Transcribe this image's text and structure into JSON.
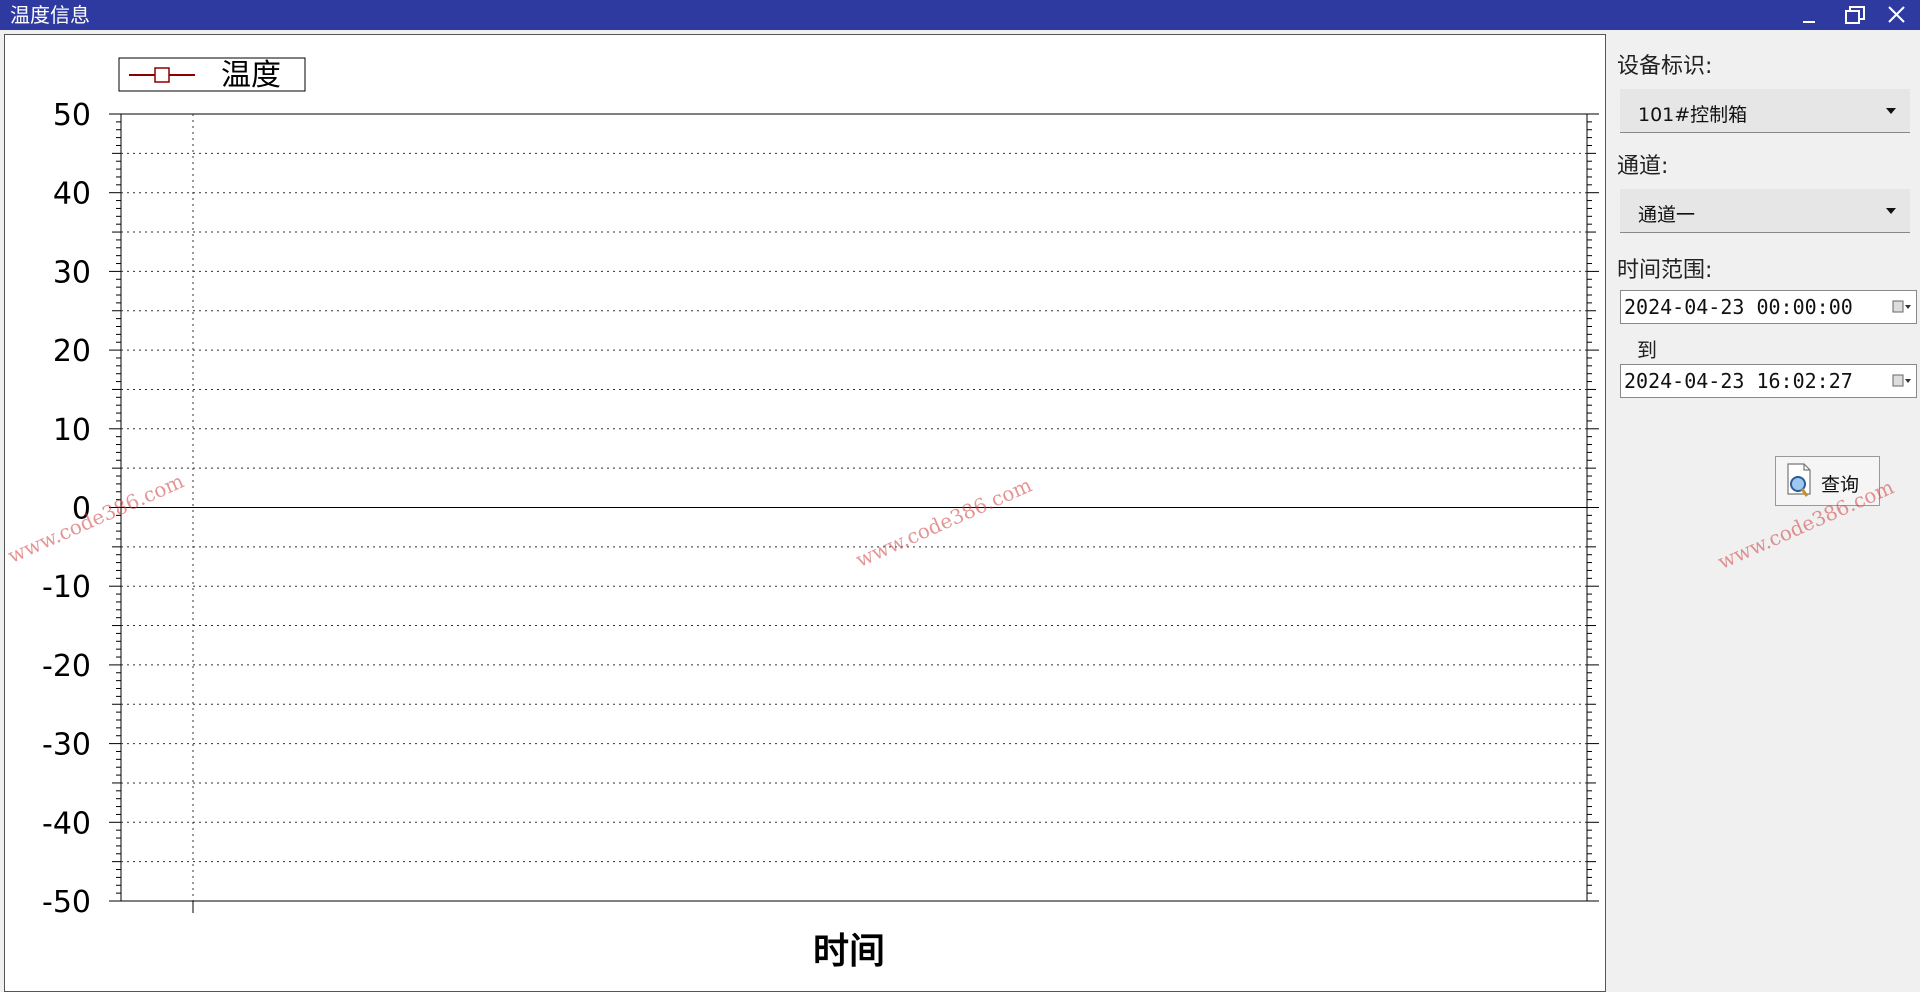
{
  "window": {
    "title": "温度信息"
  },
  "chart_data": {
    "type": "line",
    "legend": [
      "温度"
    ],
    "series": [
      {
        "name": "温度",
        "values": []
      }
    ],
    "xlabel": "时间",
    "ylabel": "",
    "ylim": [
      -50,
      50
    ],
    "yticks": [
      50,
      40,
      30,
      20,
      10,
      0,
      -10,
      -20,
      -30,
      -40,
      -50
    ],
    "grid": true,
    "legend_position": "top-left",
    "series_color": "#8b0000"
  },
  "sidebar": {
    "device_label": "设备标识:",
    "device_value": "101#控制箱",
    "channel_label": "通道:",
    "channel_value": "通道一",
    "time_range_label": "时间范围:",
    "start_time": "2024-04-23 00:00:00",
    "to_label": "到",
    "end_time": "2024-04-23 16:02:27",
    "query_label": "查询"
  },
  "watermark": {
    "text": "www.code386.com"
  }
}
